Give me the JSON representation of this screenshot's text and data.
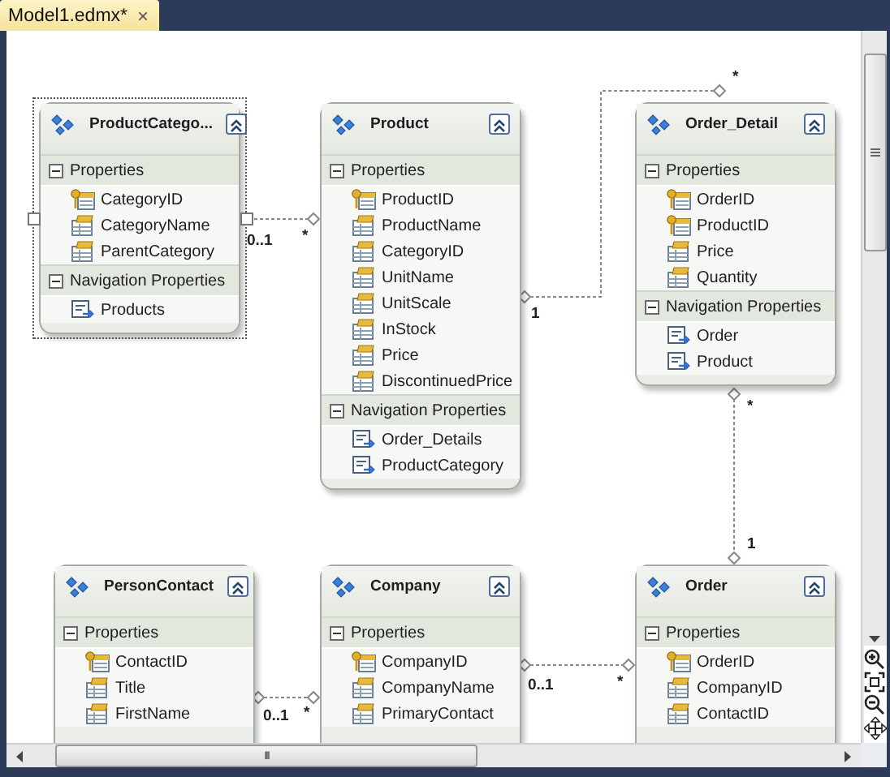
{
  "tab": {
    "label": "Model1.edmx*",
    "close": "×"
  },
  "entities": [
    {
      "name": "ProductCatego...",
      "selected": true,
      "sections": [
        {
          "title": "Properties",
          "expanded": true,
          "items": [
            {
              "name": "CategoryID",
              "kind": "key"
            },
            {
              "name": "CategoryName",
              "kind": "property"
            },
            {
              "name": "ParentCategory",
              "kind": "property"
            }
          ]
        },
        {
          "title": "Navigation Properties",
          "expanded": true,
          "items": [
            {
              "name": "Products",
              "kind": "navigation"
            }
          ]
        }
      ]
    },
    {
      "name": "Product",
      "selected": false,
      "sections": [
        {
          "title": "Properties",
          "expanded": true,
          "items": [
            {
              "name": "ProductID",
              "kind": "key"
            },
            {
              "name": "ProductName",
              "kind": "property"
            },
            {
              "name": "CategoryID",
              "kind": "property"
            },
            {
              "name": "UnitName",
              "kind": "property"
            },
            {
              "name": "UnitScale",
              "kind": "property"
            },
            {
              "name": "InStock",
              "kind": "property"
            },
            {
              "name": "Price",
              "kind": "property"
            },
            {
              "name": "DiscontinuedPrice",
              "kind": "property"
            }
          ]
        },
        {
          "title": "Navigation Properties",
          "expanded": true,
          "items": [
            {
              "name": "Order_Details",
              "kind": "navigation"
            },
            {
              "name": "ProductCategory",
              "kind": "navigation"
            }
          ]
        }
      ]
    },
    {
      "name": "Order_Detail",
      "selected": false,
      "sections": [
        {
          "title": "Properties",
          "expanded": true,
          "items": [
            {
              "name": "OrderID",
              "kind": "key"
            },
            {
              "name": "ProductID",
              "kind": "key"
            },
            {
              "name": "Price",
              "kind": "property"
            },
            {
              "name": "Quantity",
              "kind": "property"
            }
          ]
        },
        {
          "title": "Navigation Properties",
          "expanded": true,
          "items": [
            {
              "name": "Order",
              "kind": "navigation"
            },
            {
              "name": "Product",
              "kind": "navigation"
            }
          ]
        }
      ]
    },
    {
      "name": "PersonContact",
      "selected": false,
      "sections": [
        {
          "title": "Properties",
          "expanded": true,
          "items": [
            {
              "name": "ContactID",
              "kind": "key"
            },
            {
              "name": "Title",
              "kind": "property"
            },
            {
              "name": "FirstName",
              "kind": "property"
            }
          ]
        }
      ]
    },
    {
      "name": "Company",
      "selected": false,
      "sections": [
        {
          "title": "Properties",
          "expanded": true,
          "items": [
            {
              "name": "CompanyID",
              "kind": "key"
            },
            {
              "name": "CompanyName",
              "kind": "property"
            },
            {
              "name": "PrimaryContact",
              "kind": "property"
            }
          ]
        }
      ]
    },
    {
      "name": "Order",
      "selected": false,
      "sections": [
        {
          "title": "Properties",
          "expanded": true,
          "items": [
            {
              "name": "OrderID",
              "kind": "key"
            },
            {
              "name": "CompanyID",
              "kind": "property"
            },
            {
              "name": "ContactID",
              "kind": "property"
            }
          ]
        }
      ]
    }
  ],
  "associations": [
    {
      "end1": "0..1",
      "end2": "*"
    },
    {
      "end1": "1",
      "end2": "*"
    },
    {
      "end1": "*",
      "end2": "1"
    },
    {
      "end1": "0..1",
      "end2": "*"
    },
    {
      "end1": "0..1",
      "end2": "*"
    }
  ],
  "scrollbar_grip": "III"
}
